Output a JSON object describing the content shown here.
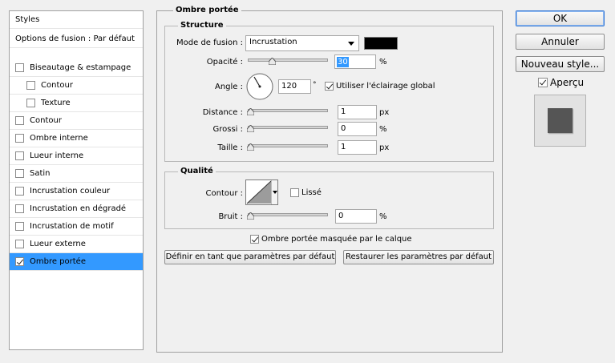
{
  "left_panel": {
    "header": "Styles",
    "blend_options": "Options de fusion : Par défaut",
    "items": [
      {
        "label": "Biseautage & estampage",
        "checked": false,
        "indent": false,
        "selected": false
      },
      {
        "label": "Contour",
        "checked": false,
        "indent": true,
        "selected": false
      },
      {
        "label": "Texture",
        "checked": false,
        "indent": true,
        "selected": false
      },
      {
        "label": "Contour",
        "checked": false,
        "indent": false,
        "selected": false
      },
      {
        "label": "Ombre interne",
        "checked": false,
        "indent": false,
        "selected": false
      },
      {
        "label": "Lueur interne",
        "checked": false,
        "indent": false,
        "selected": false
      },
      {
        "label": "Satin",
        "checked": false,
        "indent": false,
        "selected": false
      },
      {
        "label": "Incrustation couleur",
        "checked": false,
        "indent": false,
        "selected": false
      },
      {
        "label": "Incrustation en dégradé",
        "checked": false,
        "indent": false,
        "selected": false
      },
      {
        "label": "Incrustation de motif",
        "checked": false,
        "indent": false,
        "selected": false
      },
      {
        "label": "Lueur externe",
        "checked": false,
        "indent": false,
        "selected": false
      },
      {
        "label": "Ombre portée",
        "checked": true,
        "indent": false,
        "selected": true
      }
    ]
  },
  "main": {
    "title": "Ombre portée",
    "structure": {
      "title": "Structure",
      "blend_mode_label": "Mode de fusion :",
      "blend_mode_value": "Incrustation",
      "color_swatch": "#000000",
      "opacity_label": "Opacité :",
      "opacity_value": "30",
      "opacity_unit": "%",
      "opacity_fraction": 0.3,
      "angle_label": "Angle :",
      "angle_value": "120",
      "angle_unit": "°",
      "global_light_label": "Utiliser l'éclairage global",
      "global_light_checked": true,
      "distance_label": "Distance :",
      "distance_value": "1",
      "distance_unit": "px",
      "spread_label": "Grossi :",
      "spread_value": "0",
      "spread_unit": "%",
      "size_label": "Taille :",
      "size_value": "1",
      "size_unit": "px"
    },
    "quality": {
      "title": "Qualité",
      "contour_label": "Contour :",
      "antialias_label": "Lissé",
      "antialias_checked": false,
      "noise_label": "Bruit :",
      "noise_value": "0",
      "noise_unit": "%"
    },
    "knockout_label": "Ombre portée masquée par le calque",
    "knockout_checked": true,
    "make_default_label": "Définir en tant que paramètres par défaut",
    "reset_default_label": "Restaurer les paramètres par défaut"
  },
  "right_panel": {
    "ok_label": "OK",
    "cancel_label": "Annuler",
    "new_style_label": "Nouveau style...",
    "preview_label": "Aperçu",
    "preview_checked": true
  }
}
